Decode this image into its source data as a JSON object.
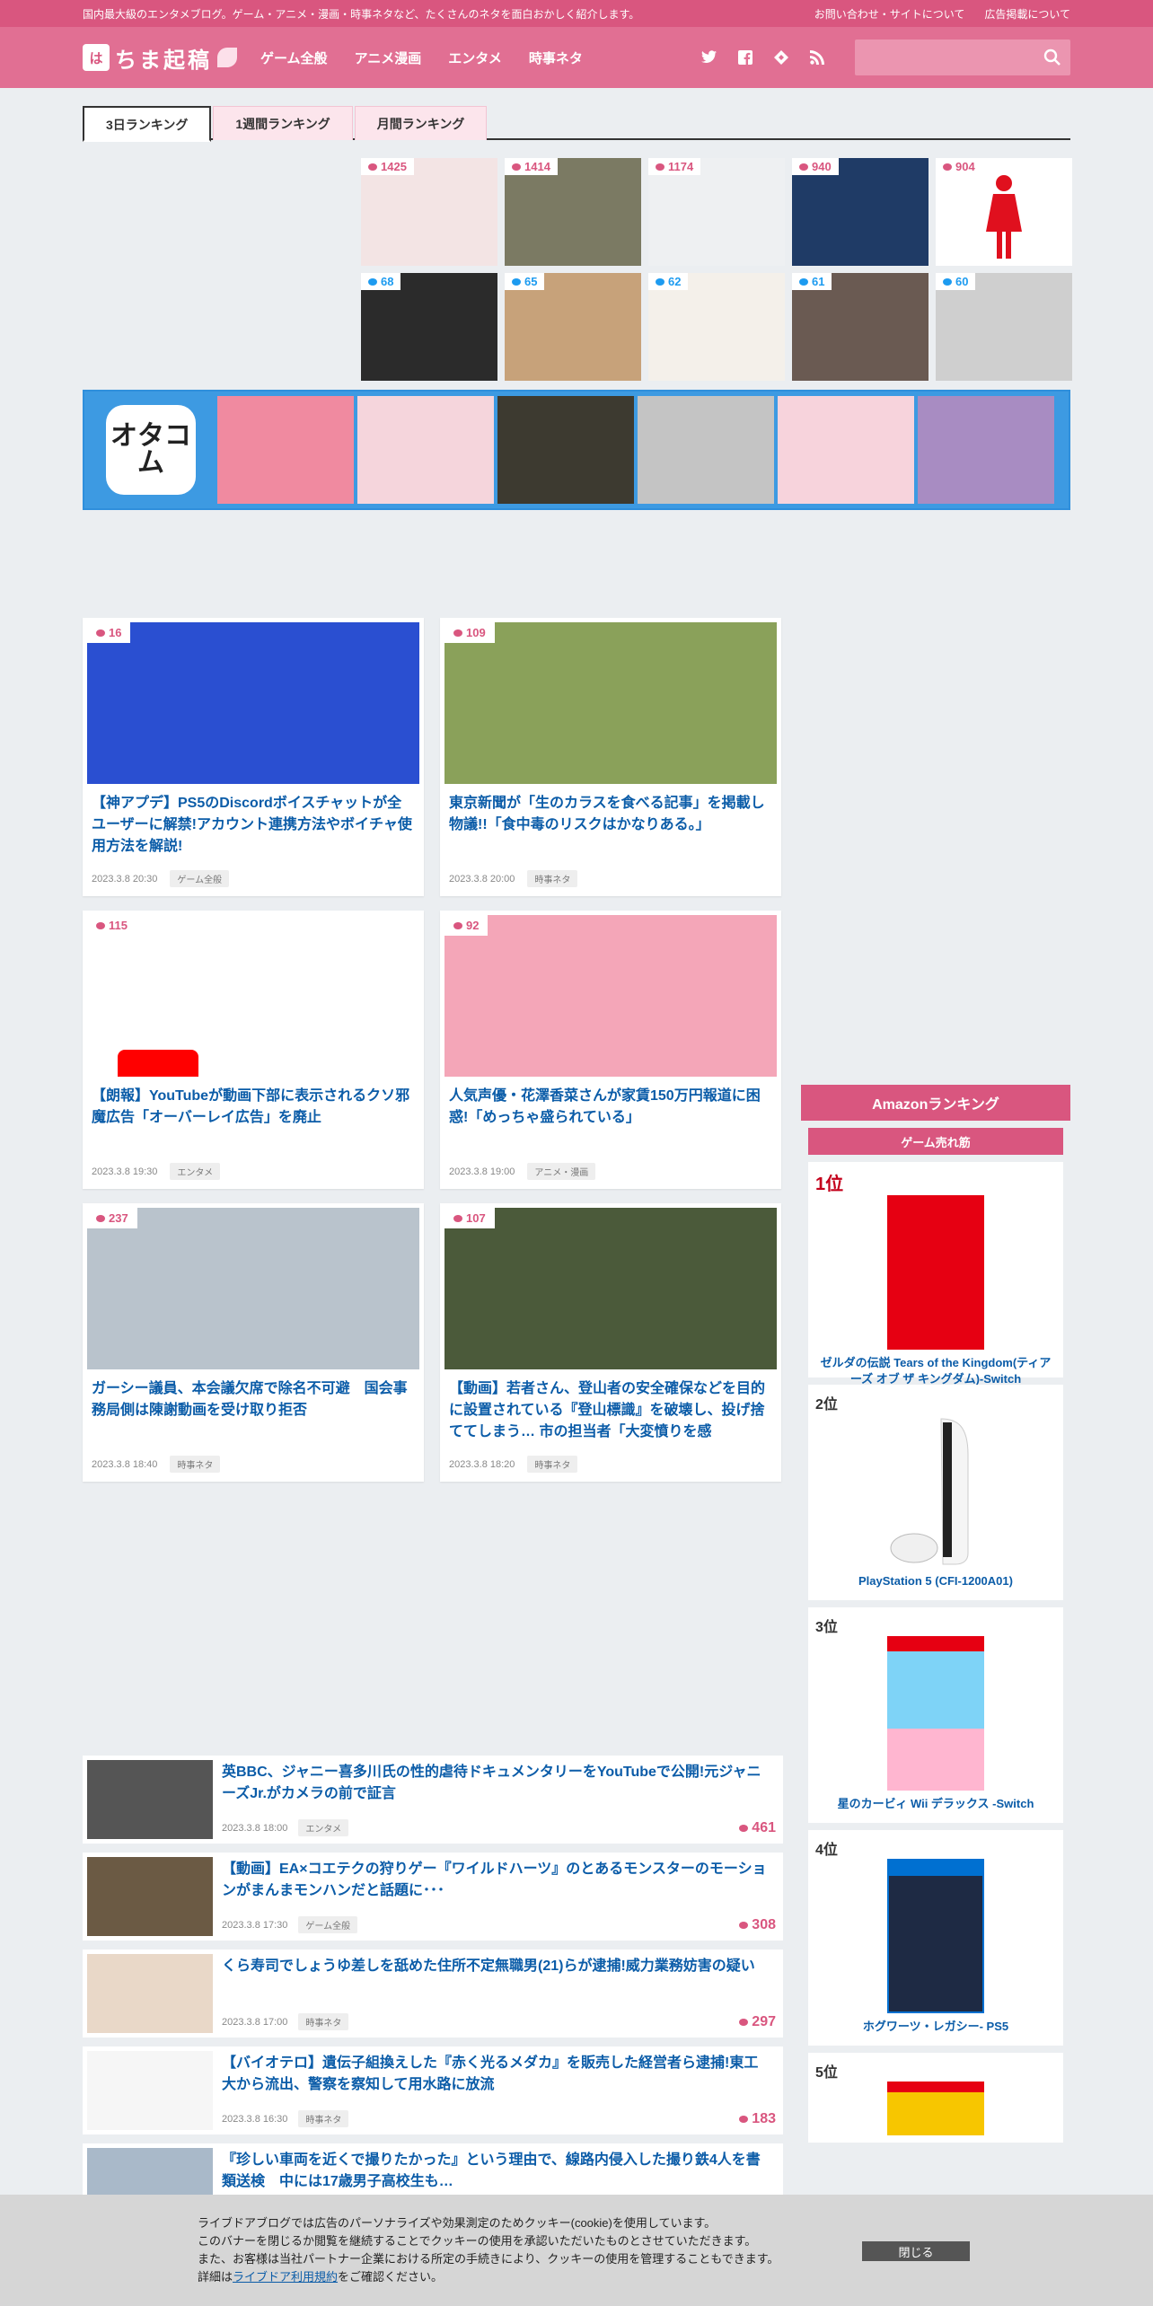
{
  "topstrip": {
    "tagline": "国内最大級のエンタメブログ。ゲーム・アニメ・漫画・時事ネタなど、たくさんのネタを面白おかしく紹介します。",
    "link_contact": "お問い合わせ・サイトについて",
    "link_ads": "広告掲載について"
  },
  "header": {
    "logo_mark": "は",
    "logo_text": "ちま起稿",
    "nav": [
      "ゲーム全般",
      "アニメ漫画",
      "エンタメ",
      "時事ネタ"
    ],
    "social_icons": [
      "twitter-icon",
      "facebook-icon",
      "feedly-icon",
      "rss-icon"
    ],
    "search_placeholder": ""
  },
  "ranking": {
    "tabs": [
      "3日ランキング",
      "1週間ランキング",
      "月間ランキング"
    ],
    "active_tab": 0,
    "row1_counts": [
      "1425",
      "1414",
      "1174",
      "940",
      "904"
    ],
    "row2_counts": [
      "68",
      "65",
      "62",
      "61",
      "60"
    ]
  },
  "otacom": {
    "logo_text": "オタコム"
  },
  "cards": [
    {
      "count": "16",
      "title": "【神アプデ】PS5のDiscordボイスチャットが全ユーザーに解禁!アカウント連携方法やボイチャ使用方法を解説!",
      "date": "2023.3.8 20:30",
      "tag": "ゲーム全般",
      "bg": "#2a4fd1"
    },
    {
      "count": "109",
      "title": "東京新聞が「生のカラスを食べる記事」を掲載し物議!!「食中毒のリスクはかなりある。」",
      "date": "2023.3.8 20:00",
      "tag": "時事ネタ",
      "bg": "#8aa15a"
    },
    {
      "count": "115",
      "title": "【朗報】YouTubeが動画下部に表示されるクソ邪魔広告「オーバーレイ広告」を廃止",
      "date": "2023.3.8 19:30",
      "tag": "エンタメ",
      "bg": "#ffffff"
    },
    {
      "count": "92",
      "title": "人気声優・花澤香菜さんが家賃150万円報道に困惑!「めっちゃ盛られている」",
      "date": "2023.3.8 19:00",
      "tag": "アニメ・漫画",
      "bg": "#f4a6b8"
    },
    {
      "count": "237",
      "title": "ガーシー議員、本会議欠席で除名不可避　国会事務局側は陳謝動画を受け取り拒否",
      "date": "2023.3.8 18:40",
      "tag": "時事ネタ",
      "bg": "#b9c3cc"
    },
    {
      "count": "107",
      "title": "【動画】若者さん、登山者の安全確保などを目的に設置されている『登山標識』を破壊し、投げ捨ててしまう… 市の担当者「大変憤りを感",
      "date": "2023.3.8 18:20",
      "tag": "時事ネタ",
      "bg": "#4b5a3a"
    }
  ],
  "list": [
    {
      "title": "英BBC、ジャニー喜多川氏の性的虐待ドキュメンタリーをYouTubeで公開!元ジャニーズJr.がカメラの前で証言",
      "date": "2023.3.8 18:00",
      "tag": "エンタメ",
      "count": "461",
      "bg": "#555555"
    },
    {
      "title": "【動画】EA×コエテクの狩りゲー『ワイルドハーツ』のとあるモンスターのモーションがまんまモンハンだと話題に･･･",
      "date": "2023.3.8 17:30",
      "tag": "ゲーム全般",
      "count": "308",
      "bg": "#6b5a44"
    },
    {
      "title": "くら寿司でしょうゆ差しを舐めた住所不定無職男(21)らが逮捕!威力業務妨害の疑い",
      "date": "2023.3.8 17:00",
      "tag": "時事ネタ",
      "count": "297",
      "bg": "#e9d8c8"
    },
    {
      "title": "【バイオテロ】遺伝子組換えした『赤く光るメダカ』を販売した経営者ら逮捕!東工大から流出、警察を察知して用水路に放流",
      "date": "2023.3.8 16:30",
      "tag": "時事ネタ",
      "count": "183",
      "bg": "#f6f6f6"
    },
    {
      "title": "『珍しい車両を近くで撮りたかった』という理由で、線路内侵入した撮り鉄4人を書類送検　中には17歳男子高校生も…",
      "date": "",
      "tag": "",
      "count": "",
      "bg": "#a9b9c9"
    }
  ],
  "amazon": {
    "header": "Amazonランキング",
    "category": "ゲーム売れ筋",
    "items": [
      {
        "rank": "1位",
        "name": "ゼルダの伝説 Tears of the Kingdom(ティアーズ オブ ザ キングダム)-Switch",
        "color": "#e60012"
      },
      {
        "rank": "2位",
        "name": "PlayStation 5 (CFI-1200A01)",
        "color": "#ffffff"
      },
      {
        "rank": "3位",
        "name": "星のカービィ Wii デラックス -Switch",
        "color": "#e60012"
      },
      {
        "rank": "4位",
        "name": "ホグワーツ・レガシー- PS5",
        "color": "#0070d1"
      },
      {
        "rank": "5位",
        "name": "",
        "color": "#e60012"
      }
    ]
  },
  "cookie": {
    "line1": "ライブドアブログでは広告のパーソナライズや効果測定のためクッキー(cookie)を使用しています。",
    "line2": "このバナーを閉じるか閲覧を継続することでクッキーの使用を承認いただいたものとさせていただきます。",
    "line3": "また、お客様は当社パートナー企業における所定の手続きにより、クッキーの使用を管理することもできます。",
    "line4_prefix": "詳細は",
    "line4_link": "ライブドア利用規約",
    "line4_suffix": "をご確認ください。",
    "close_label": "閉じる"
  }
}
